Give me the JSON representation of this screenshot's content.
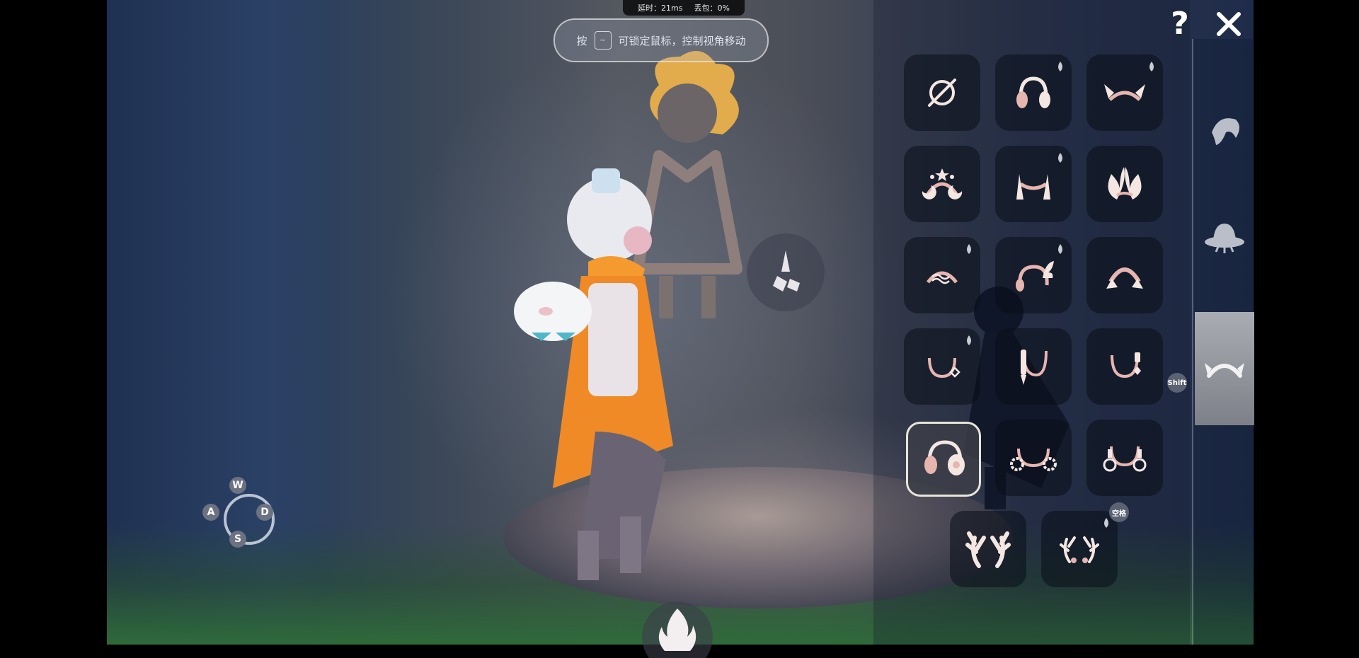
{
  "stats": {
    "latency_label": "延时：21ms",
    "packet_loss_label": "丢包：0%"
  },
  "hint": {
    "prefix": "按",
    "key": "~",
    "text": "可锁定鼠标，控制视角移动"
  },
  "controls": {
    "help_label": "?",
    "close_icon": "close-icon"
  },
  "categories": [
    {
      "icon": "hair-icon",
      "selected": false
    },
    {
      "icon": "hat-icon",
      "selected": false
    },
    {
      "icon": "headwear-icon",
      "selected": true
    }
  ],
  "items": [
    {
      "icon": "none-icon",
      "droplet": false,
      "selected": false
    },
    {
      "icon": "headphones-icon",
      "droplet": true,
      "selected": false
    },
    {
      "icon": "horned-headband-icon",
      "droplet": true,
      "selected": false
    },
    {
      "icon": "moon-stars-headband-icon",
      "droplet": false,
      "selected": false
    },
    {
      "icon": "tassel-headband-icon",
      "droplet": true,
      "selected": false
    },
    {
      "icon": "leaf-ears-icon",
      "droplet": false,
      "selected": false
    },
    {
      "icon": "wave-headband-icon",
      "droplet": true,
      "selected": false
    },
    {
      "icon": "winged-headband-icon",
      "droplet": true,
      "selected": false
    },
    {
      "icon": "tasseled-arc-icon",
      "droplet": false,
      "selected": false
    },
    {
      "icon": "diamond-pendant-headband-icon",
      "droplet": true,
      "selected": false
    },
    {
      "icon": "brush-headband-icon",
      "droplet": false,
      "selected": false
    },
    {
      "icon": "drop-pendant-headband-icon",
      "droplet": false,
      "selected": false
    },
    {
      "icon": "headphones-icon",
      "droplet": false,
      "selected": true
    },
    {
      "icon": "sun-gear-headband-icon",
      "droplet": false,
      "selected": false
    },
    {
      "icon": "orb-headband-icon",
      "droplet": false,
      "selected": false
    },
    {
      "icon": "antlers-icon",
      "droplet": false,
      "selected": false
    },
    {
      "icon": "small-antlers-icon",
      "droplet": true,
      "selected": false
    }
  ],
  "badges": {
    "shift_label": "Shift",
    "space_label": "空格"
  },
  "movement": {
    "up": "W",
    "left": "A",
    "right": "D",
    "down": "S"
  },
  "colors": {
    "icon_fill": "#f4e7e2",
    "icon_accent": "#e7b5b0",
    "slot_bg": "#0e1422"
  }
}
